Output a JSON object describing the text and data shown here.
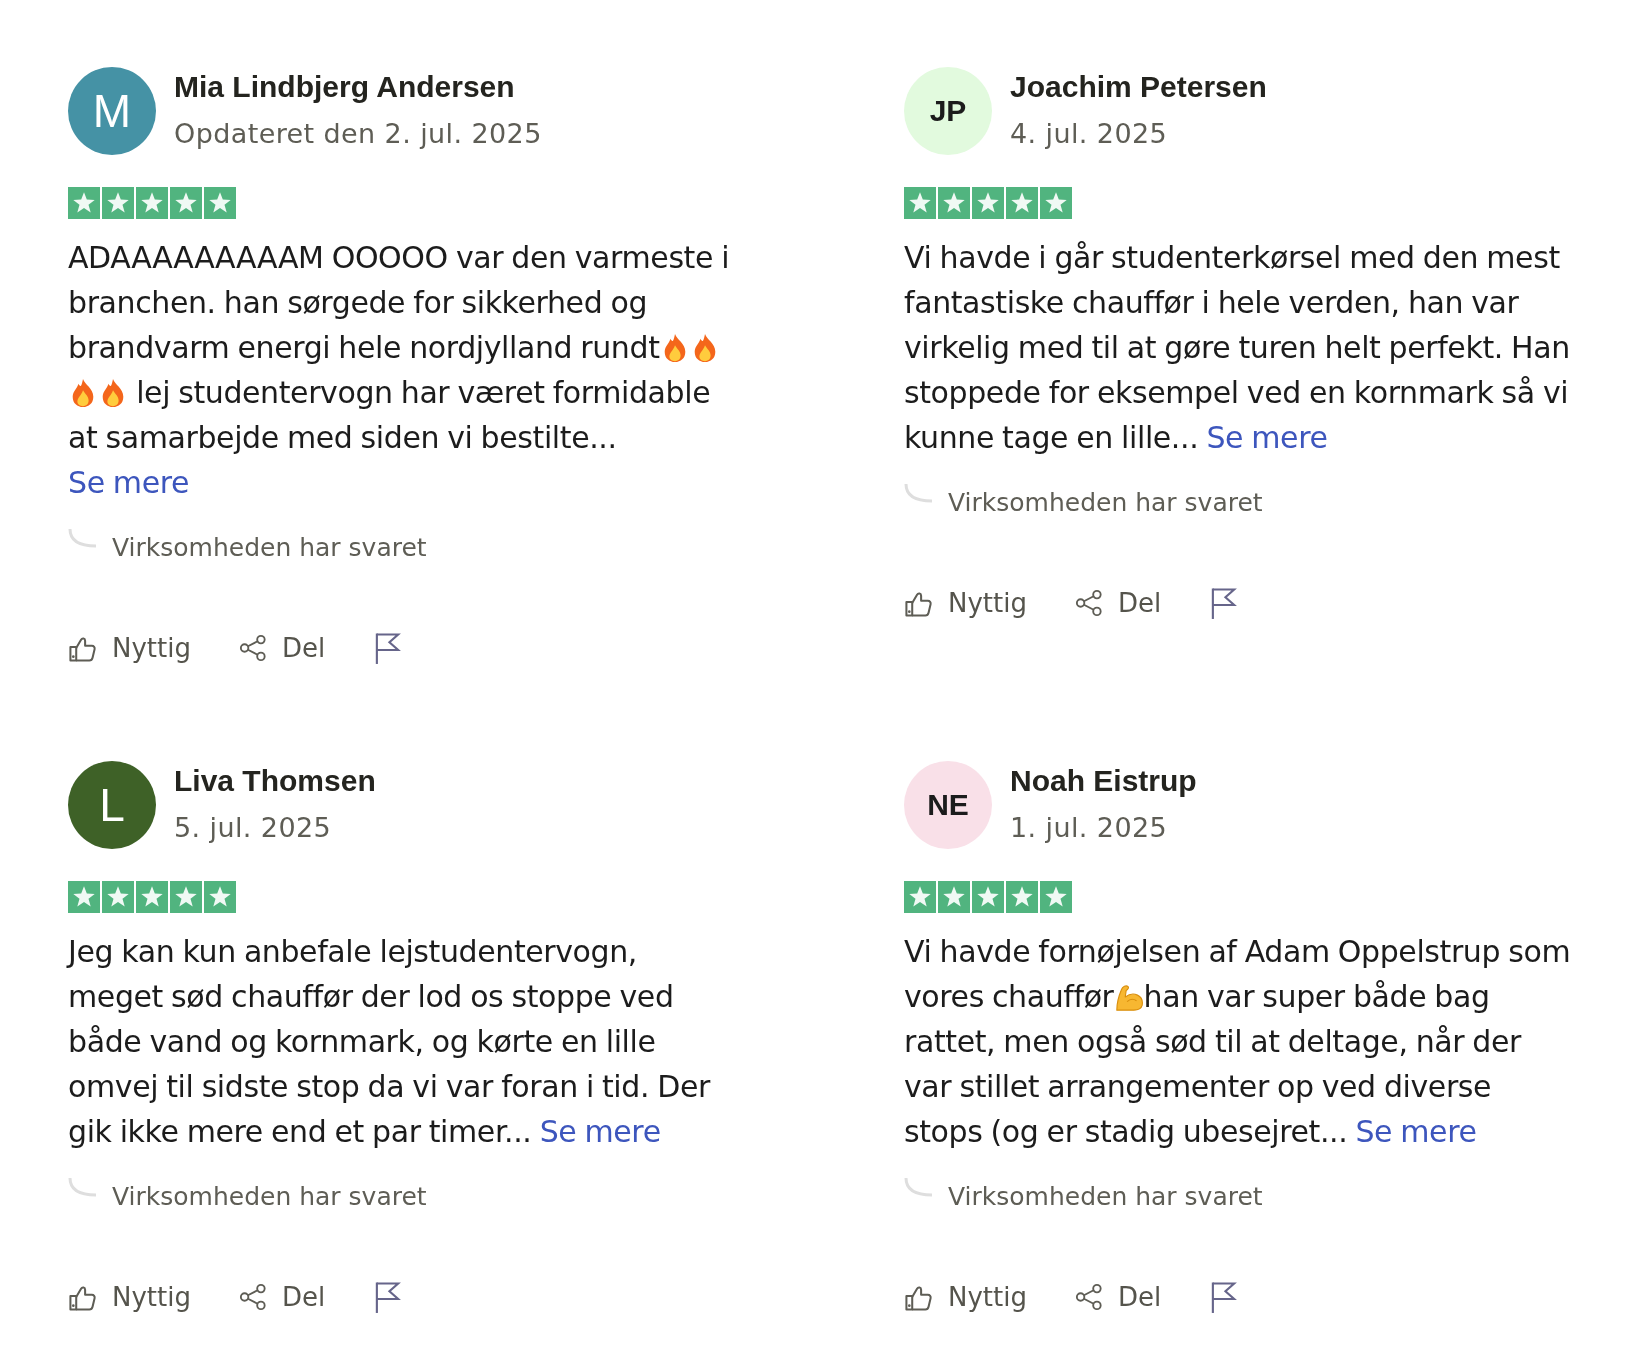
{
  "reviews": [
    {
      "author": {
        "name": "Mia Lindbjerg Andersen",
        "initials": "M",
        "color": "#4592a5"
      },
      "date": "Opdateret den 2. jul. 2025",
      "stars": 5,
      "body": [
        {
          "kind": "text",
          "text": "ADAAAAAAAAAM OOOOO var den varmeste i branchen. han sørgede for sikkerhed og brandvarm energi hele nordjylland rundt"
        },
        {
          "kind": "fire"
        },
        {
          "kind": "fire"
        },
        {
          "kind": "fire"
        },
        {
          "kind": "fire"
        },
        {
          "kind": "text",
          "text": " lej studentervogn har været formidable at samarbejde med siden vi bestilte..."
        }
      ],
      "more_link": "Se mere",
      "reply_label": "Virksomheden har svaret",
      "actions": [
        {
          "kind": "helpful",
          "label": "Nyttig"
        },
        {
          "kind": "share",
          "label": "Del"
        },
        {
          "kind": "report"
        }
      ]
    },
    {
      "author": {
        "name": "Joachim Petersen",
        "initials": "JP",
        "color": "#e2fade"
      },
      "date": "4. jul. 2025",
      "stars": 5,
      "body": [
        {
          "kind": "text",
          "text": "Vi havde i går studenterkørsel med den mest fantastiske chauffør i hele verden, han var virkelig med til at gøre turen helt perfekt. Han stoppede for eksempel ved en kornmark så vi kunne tage en lille..."
        }
      ],
      "more_link": "Se mere",
      "reply_label": "Virksomheden har svaret",
      "actions": [
        {
          "kind": "helpful",
          "label": "Nyttig"
        },
        {
          "kind": "share",
          "label": "Del"
        },
        {
          "kind": "report"
        }
      ]
    },
    {
      "author": {
        "name": "Liva Thomsen",
        "initials": "L",
        "color": "#3e6127"
      },
      "date": "5. jul. 2025",
      "stars": 5,
      "body": [
        {
          "kind": "text",
          "text": "Jeg kan kun anbefale lejstudentervogn, meget sød chauffør der lod os stoppe ved både vand og kornmark, og kørte en lille omvej til sidste stop da vi var foran i tid. Der gik ikke mere end et par timer..."
        }
      ],
      "more_link": "Se mere",
      "reply_label": "Virksomheden har svaret",
      "actions": [
        {
          "kind": "helpful",
          "label": "Nyttig"
        },
        {
          "kind": "share",
          "label": "Del"
        },
        {
          "kind": "report"
        }
      ]
    },
    {
      "author": {
        "name": "Noah Eistrup",
        "initials": "NE",
        "color": "#f9e0e8"
      },
      "date": "1. jul. 2025",
      "stars": 5,
      "body": [
        {
          "kind": "text",
          "text": "Vi havde fornøjelsen af Adam Oppelstrup som vores chauffør"
        },
        {
          "kind": "muscle"
        },
        {
          "kind": "text",
          "text": "han var super både bag rattet, men også sød til at deltage, når der var stillet arrangementer op ved diverse stops (og er stadig ubesejret..."
        }
      ],
      "more_link": "Se mere",
      "reply_label": "Virksomheden har svaret",
      "actions": [
        {
          "kind": "helpful",
          "label": "Nyttig"
        },
        {
          "kind": "share",
          "label": "Del"
        },
        {
          "kind": "report"
        }
      ]
    }
  ]
}
